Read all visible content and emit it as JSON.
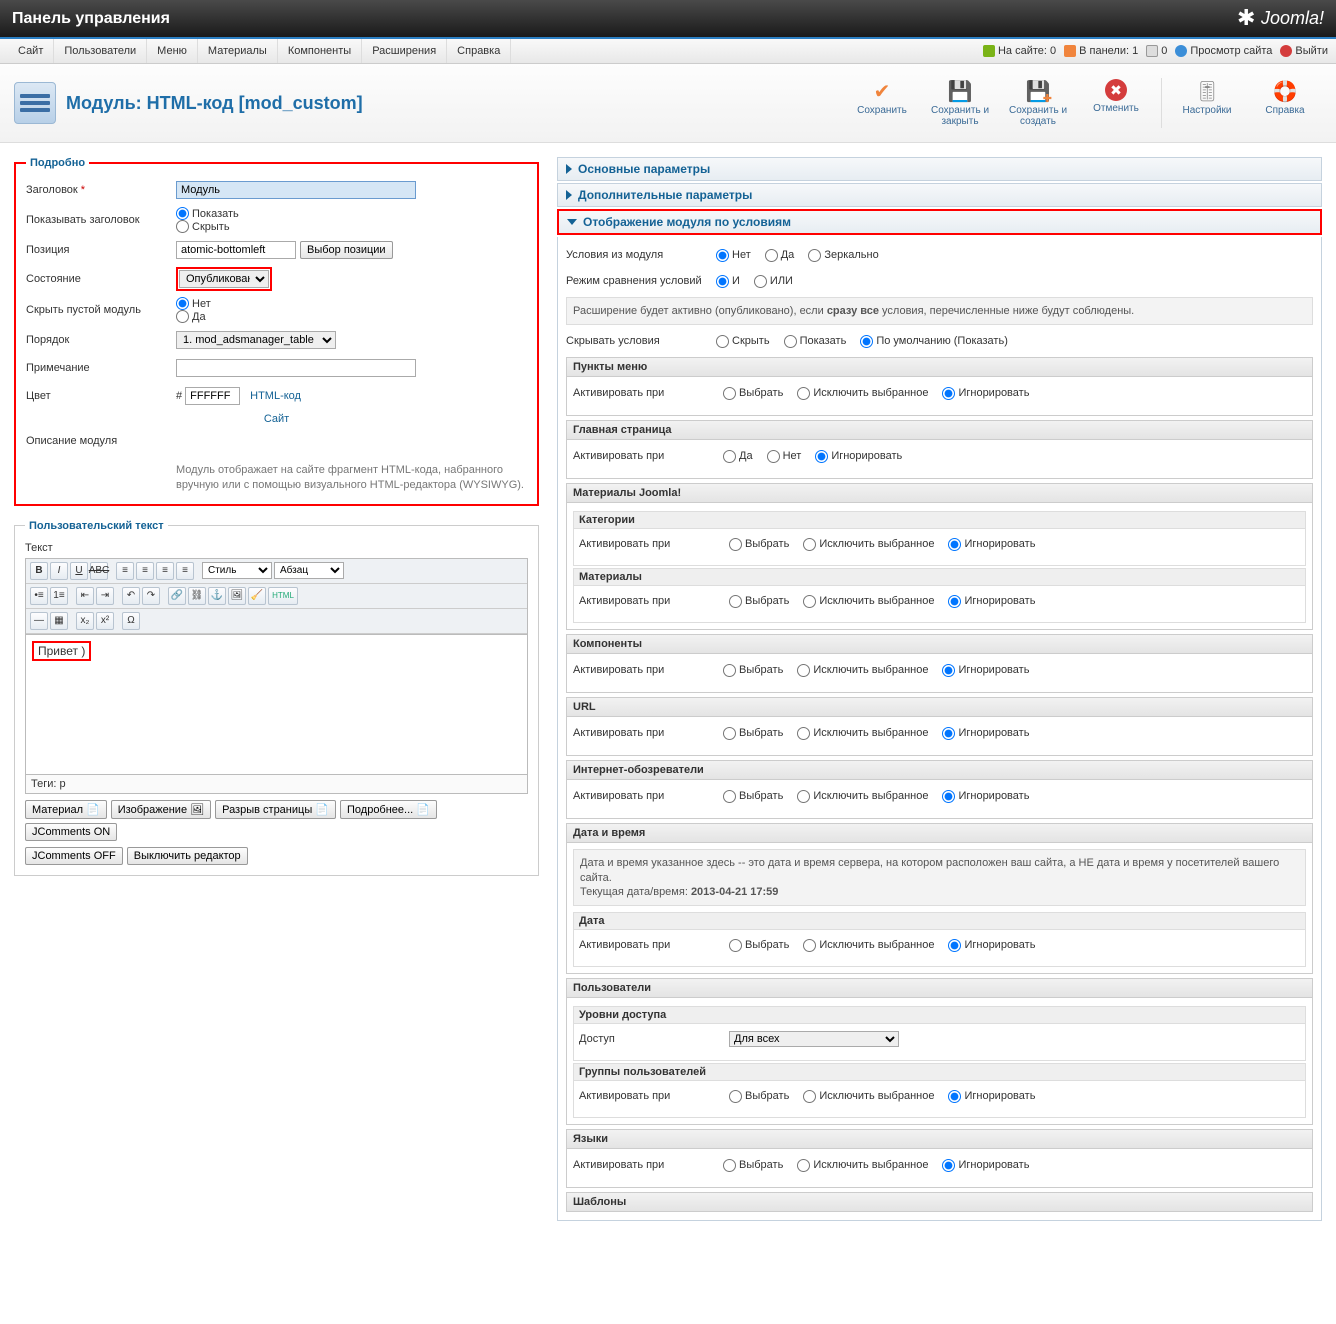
{
  "topbar": {
    "title": "Панель управления",
    "brand": "Joomla!"
  },
  "menu": {
    "items": [
      "Сайт",
      "Пользователи",
      "Меню",
      "Материалы",
      "Компоненты",
      "Расширения",
      "Справка"
    ],
    "status": {
      "onsite": "На сайте: 0",
      "inpanel": "В панели: 1",
      "mail": "0",
      "view": "Просмотр сайта",
      "logout": "Выйти"
    }
  },
  "page": {
    "title": "Модуль: HTML-код [mod_custom]"
  },
  "toolbar": {
    "save": "Сохранить",
    "saveclose": "Сохранить и закрыть",
    "savenew": "Сохранить и создать",
    "cancel": "Отменить",
    "settings": "Настройки",
    "help": "Справка"
  },
  "details": {
    "legend": "Подробно",
    "title_lbl": "Заголовок",
    "title_val": "Модуль",
    "show_lbl": "Показывать заголовок",
    "show_show": "Показать",
    "show_hide": "Скрыть",
    "pos_lbl": "Позиция",
    "pos_val": "atomic-bottomleft",
    "pos_btn": "Выбор позиции",
    "state_lbl": "Состояние",
    "state_val": "Опубликовано",
    "hide_lbl": "Скрыть пустой модуль",
    "hide_no": "Нет",
    "hide_yes": "Да",
    "order_lbl": "Порядок",
    "order_val": "1. mod_adsmanager_table",
    "note_lbl": "Примечание",
    "note_val": "",
    "color_lbl": "Цвет",
    "color_hash": "#",
    "color_val": "FFFFFF",
    "color_link": "HTML-код",
    "site_link": "Сайт",
    "moddesc_lbl": "Описание модуля",
    "moddesc": "Модуль отображает на сайте фрагмент HTML-кода, набранного вручную или с помощью визуального HTML-редактора (WYSIWYG)."
  },
  "editor": {
    "legend": "Пользовательский текст",
    "label": "Текст",
    "style_sel": "Стиль",
    "para_sel": "Абзац",
    "content": "Привет )",
    "tags": "Теги: p",
    "btns": {
      "material": "Материал",
      "image": "Изображение",
      "break": "Разрыв страницы",
      "more": "Подробнее...",
      "jcon": "JComments ON",
      "jcoff": "JComments OFF",
      "off": "Выключить редактор"
    }
  },
  "panels": {
    "basic": "Основные параметры",
    "adv": "Дополнительные параметры",
    "cond": "Отображение модуля по условиям"
  },
  "cond": {
    "fromModule_lbl": "Условия из модуля",
    "no": "Нет",
    "yes": "Да",
    "mirror": "Зеркально",
    "mode_lbl": "Режим сравнения условий",
    "and": "И",
    "or": "ИЛИ",
    "note": "Расширение будет активно (опубликовано), если сразу все условия, перечисленные ниже будут соблюдены.",
    "hideCond_lbl": "Скрывать условия",
    "hide": "Скрыть",
    "show": "Показать",
    "default": "По умолчанию (Показать)",
    "activate": "Активировать при",
    "select": "Выбрать",
    "exclude": "Исключить выбранное",
    "ignore": "Игнорировать",
    "sec_menu": "Пункты меню",
    "sec_home": "Главная страница",
    "sec_joomla": "Материалы Joomla!",
    "sub_cat": "Категории",
    "sub_mat": "Материалы",
    "sec_comp": "Компоненты",
    "sec_url": "URL",
    "sec_browsers": "Интернет-обозреватели",
    "sec_date": "Дата и время",
    "date_note": "Дата и время указанное здесь -- это дата и время сервера, на котором расположен ваш сайта, а НЕ дата и время у посетителей вашего сайта.\nТекущая дата/время: 2013-04-21 17:59",
    "sub_date": "Дата",
    "sec_users": "Пользователи",
    "sub_access": "Уровни доступа",
    "access_lbl": "Доступ",
    "access_val": "Для всех",
    "sub_groups": "Группы пользователей",
    "sec_lang": "Языки",
    "sec_tmpl": "Шаблоны"
  }
}
